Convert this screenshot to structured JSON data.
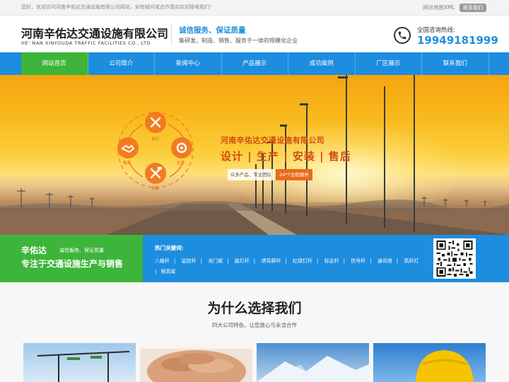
{
  "topbar": {
    "welcome": "您好，欢迎访问河南辛佑达交通设施有限公司网站，如有疑问或合作意向欢迎致电我们!",
    "sitemap": "网站地图XML",
    "contact_button": "联系我们"
  },
  "header": {
    "logo_cn": "河南辛佑达交通设施有限公司",
    "logo_en": "HE' NAN XINYOUDA TRAFFIC FACILITIES CO., LTD",
    "slogan": "诚信服务、保证质量",
    "slogan_sub": "集研发、制造、销售、服务于一体的规模化企业",
    "hotline_label": "全国咨询热线:",
    "hotline_number": "19949181999",
    "phone_icon": "phone-icon"
  },
  "nav": {
    "items": [
      {
        "label": "网站首页",
        "active": true
      },
      {
        "label": "公司简介",
        "active": false
      },
      {
        "label": "新闻中心",
        "active": false
      },
      {
        "label": "产品展示",
        "active": false
      },
      {
        "label": "成功案例",
        "active": false
      },
      {
        "label": "厂区展示",
        "active": false
      },
      {
        "label": "联系我们",
        "active": false
      }
    ],
    "active_color": "#3db53a",
    "bar_color": "#1d8ddf"
  },
  "banner": {
    "title": "河南辛佑达交通设施有限公司",
    "headline": "设计 | 生产 | 安装 | 售后",
    "tag_left": "众多产品、专业团队",
    "tag_right": "24*7全程服务",
    "nodes": [
      "设计",
      "生产",
      "安装",
      "售后"
    ],
    "node_icons": [
      "tools-icon",
      "gear-icon",
      "wrench-hammer-icon",
      "handshake-icon"
    ]
  },
  "strip": {
    "company": "辛佑达",
    "company_sub": "诚信服务、保证质量",
    "focus": "专注于交通设施生产与销售",
    "keywords_title": "热门关键词:",
    "keywords": [
      "八棱杆",
      "监控杆",
      "龙门架",
      "路灯杆",
      "诱导屏杆",
      "红绿灯杆",
      "标志杆",
      "信号杆",
      "通讯塔",
      "高杆灯",
      "限高架"
    ]
  },
  "why": {
    "title": "为什么选择我们",
    "subtitle": "四大公司特色，让您放心与永洁合作"
  }
}
